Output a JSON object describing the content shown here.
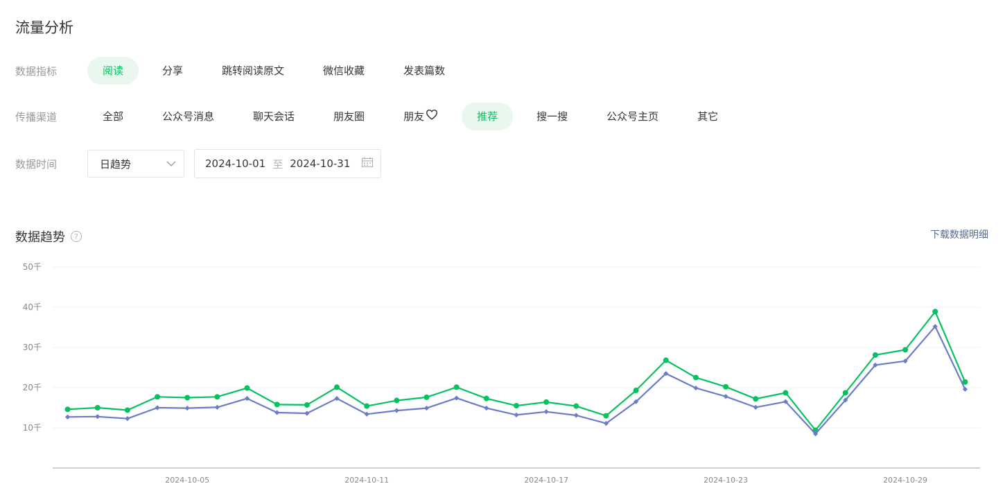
{
  "page_title": "流量分析",
  "metric_filter": {
    "label": "数据指标",
    "options": [
      "阅读",
      "分享",
      "跳转阅读原文",
      "微信收藏",
      "发表篇数"
    ],
    "active_index": 0
  },
  "channel_filter": {
    "label": "传播渠道",
    "options": [
      "全部",
      "公众号消息",
      "聊天会话",
      "朋友圈",
      "朋友",
      "推荐",
      "搜一搜",
      "公众号主页",
      "其它"
    ],
    "heart_option_index": 4,
    "active_index": 5
  },
  "time_filter": {
    "label": "数据时间",
    "granularity": "日趋势",
    "start_date": "2024-10-01",
    "separator": "至",
    "end_date": "2024-10-31"
  },
  "trend_section": {
    "title": "数据趋势",
    "help_icon": "?",
    "download_label": "下载数据明细"
  },
  "colors": {
    "accent": "#07c160",
    "accent_bg": "#e9f7ef",
    "series_1": "#07c160",
    "series_2": "#6a7cc9",
    "link": "#576b95"
  },
  "chart_data": {
    "type": "line",
    "x": [
      "2024-10-01",
      "2024-10-02",
      "2024-10-03",
      "2024-10-04",
      "2024-10-05",
      "2024-10-06",
      "2024-10-07",
      "2024-10-08",
      "2024-10-09",
      "2024-10-10",
      "2024-10-11",
      "2024-10-12",
      "2024-10-13",
      "2024-10-14",
      "2024-10-15",
      "2024-10-16",
      "2024-10-17",
      "2024-10-18",
      "2024-10-19",
      "2024-10-20",
      "2024-10-21",
      "2024-10-22",
      "2024-10-23",
      "2024-10-24",
      "2024-10-25",
      "2024-10-26",
      "2024-10-27",
      "2024-10-28",
      "2024-10-29",
      "2024-10-30",
      "2024-10-31"
    ],
    "tick_labels": [
      "2024-10-05",
      "2024-10-11",
      "2024-10-17",
      "2024-10-23",
      "2024-10-29"
    ],
    "y_ticks": [
      10000,
      20000,
      30000,
      40000,
      50000
    ],
    "y_tick_labels": [
      "10千",
      "20千",
      "30千",
      "40千",
      "50千"
    ],
    "ylim": [
      0,
      50000
    ],
    "grid": true,
    "series": [
      {
        "marker": "circle",
        "color": "#07c160",
        "values": [
          14600,
          15000,
          14400,
          17700,
          17500,
          17700,
          19900,
          15800,
          15700,
          20100,
          15400,
          16800,
          17600,
          20100,
          17300,
          15500,
          16400,
          15400,
          13000,
          19300,
          26800,
          22500,
          20200,
          17200,
          18700,
          9400,
          18700,
          28100,
          29400,
          38900,
          21400
        ]
      },
      {
        "marker": "diamond",
        "color": "#6a7cc9",
        "values": [
          12700,
          12800,
          12300,
          15000,
          14900,
          15100,
          17300,
          13800,
          13600,
          17300,
          13400,
          14300,
          14900,
          17400,
          14900,
          13200,
          14000,
          13100,
          11100,
          16500,
          23500,
          19900,
          17800,
          15100,
          16500,
          8500,
          16900,
          25600,
          26600,
          35200,
          19600
        ]
      }
    ]
  }
}
